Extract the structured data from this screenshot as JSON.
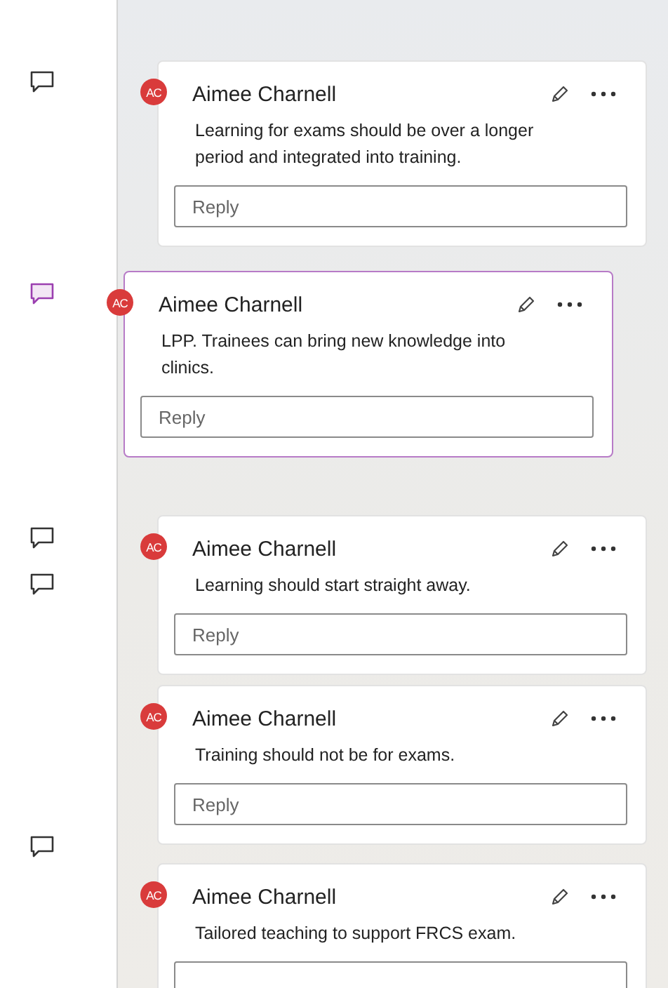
{
  "markers": [
    {
      "selected": false
    },
    {
      "selected": true
    },
    {
      "selected": false
    },
    {
      "selected": false
    },
    {
      "selected": false
    }
  ],
  "comments": [
    {
      "initials": "AC",
      "author": "Aimee Charnell",
      "text": "Learning for exams should be over a longer period and integrated into training.",
      "reply_placeholder": "Reply",
      "selected": false
    },
    {
      "initials": "AC",
      "author": "Aimee Charnell",
      "text": "LPP.  Trainees can bring new knowledge into clinics.",
      "reply_placeholder": "Reply",
      "selected": true
    },
    {
      "initials": "AC",
      "author": "Aimee Charnell",
      "text": "Learning should start straight away.",
      "reply_placeholder": "Reply",
      "selected": false
    },
    {
      "initials": "AC",
      "author": "Aimee Charnell",
      "text": "Training should not be for exams.",
      "reply_placeholder": "Reply",
      "selected": false
    },
    {
      "initials": "AC",
      "author": "Aimee Charnell",
      "text": "Tailored teaching to support FRCS exam.",
      "selected": false
    }
  ]
}
